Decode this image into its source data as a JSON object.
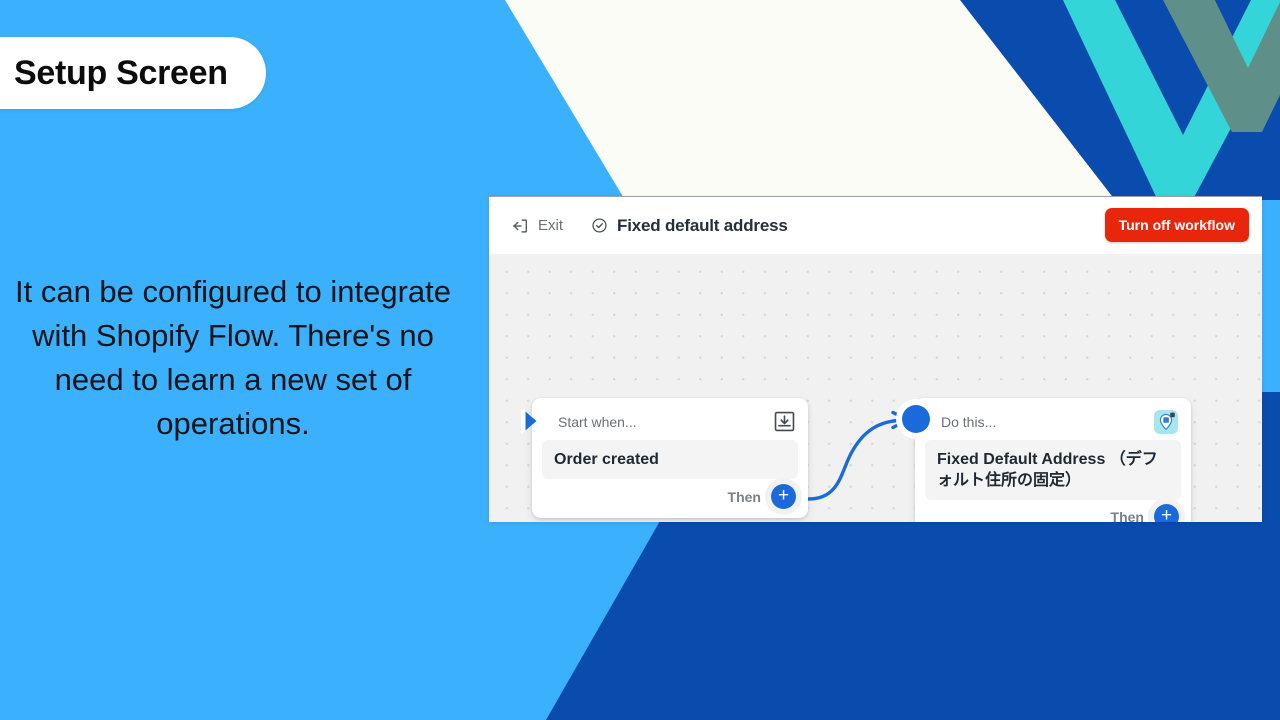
{
  "slide": {
    "title": "Setup Screen",
    "body": "It can be configured to integrate with Shopify Flow. There's no need to learn a new set of operations.",
    "colors": {
      "light_blue": "#3BB0FD",
      "dark_blue": "#0A4BAE",
      "cream": "#FCFCF7",
      "chevron_cyan": "#34D5D8",
      "chevron_teal": "#5E8F88",
      "accent_red": "#E8260C",
      "flow_blue": "#1B6ADB"
    }
  },
  "app": {
    "header": {
      "exit_label": "Exit",
      "exit_icon": "exit-arrow-icon",
      "status_icon": "check-circle-icon",
      "workflow_title": "Fixed default address",
      "turn_off_label": "Turn off workflow"
    },
    "canvas": {
      "cards": [
        {
          "id": "trigger",
          "kicker": "Start when...",
          "icon": "download-tray-icon",
          "marker": "play-triangle-marker",
          "chip_text": "Order created",
          "then_label": "Then",
          "add_label": "+"
        },
        {
          "id": "action",
          "kicker": "Do this...",
          "icon": "location-pin-app-icon",
          "marker": "dot-marker",
          "chip_text": "Fixed Default Address （デフォルト住所の固定）",
          "then_label": "Then",
          "add_label": "+"
        }
      ]
    }
  }
}
